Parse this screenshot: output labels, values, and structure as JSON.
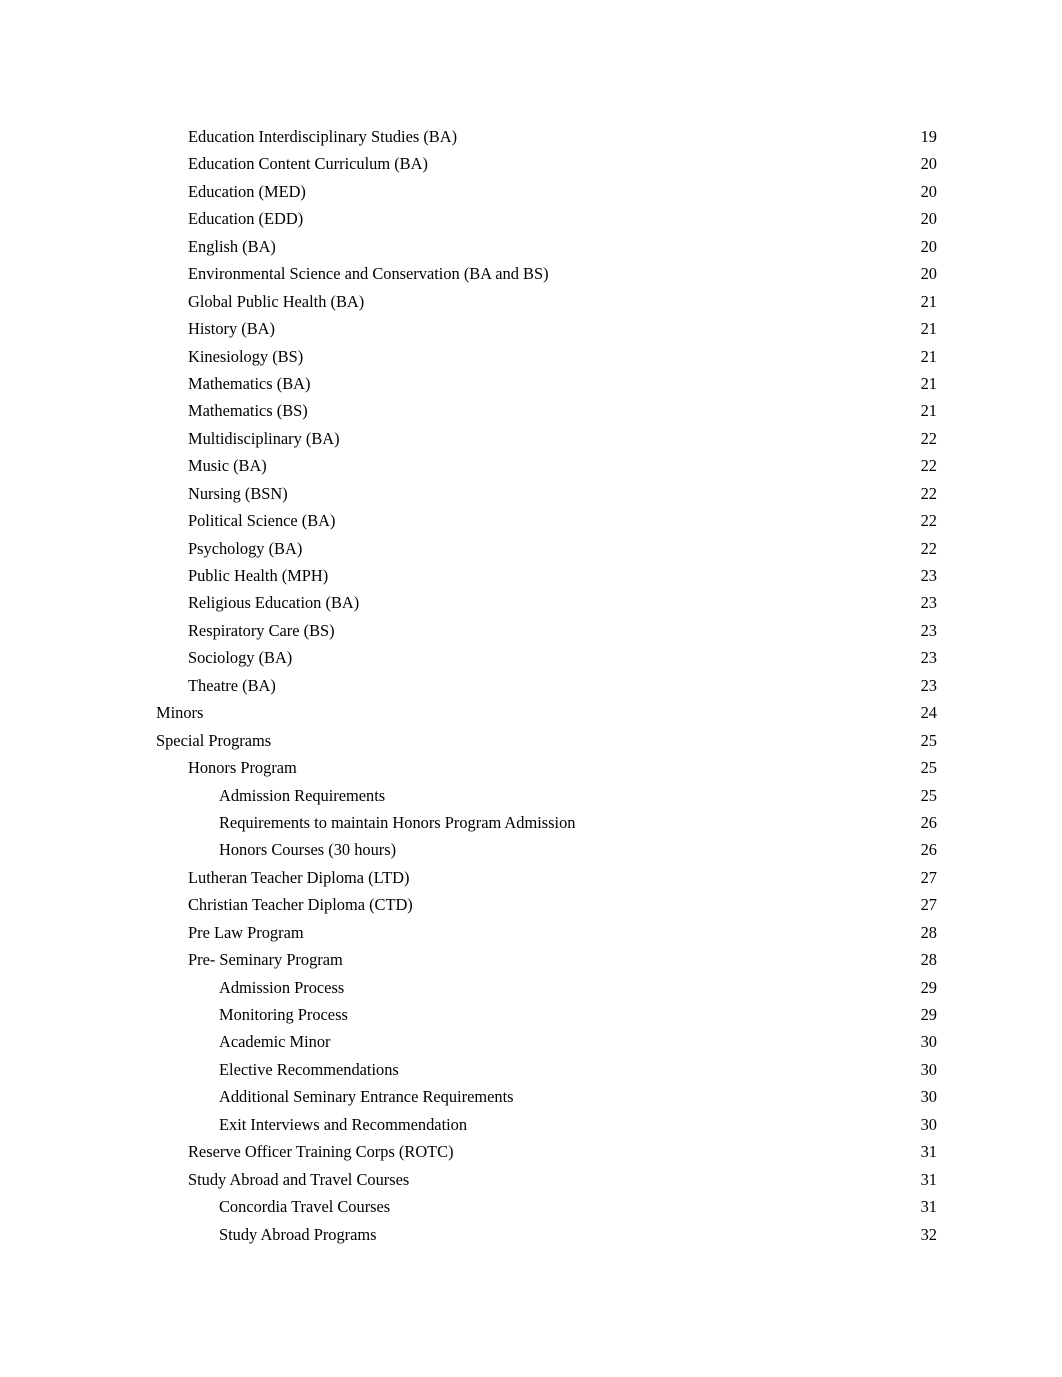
{
  "document": {
    "type": "table-of-contents",
    "page_background": "#ffffff",
    "text_color": "#000000"
  },
  "toc": {
    "entries": [
      {
        "title": "Education Interdisciplinary Studies (BA)",
        "page": "19",
        "level": 2
      },
      {
        "title": "Education Content Curriculum (BA)",
        "page": "20",
        "level": 2
      },
      {
        "title": "Education (MED)",
        "page": "20",
        "level": 2
      },
      {
        "title": "Education (EDD)",
        "page": "20",
        "level": 2
      },
      {
        "title": "English (BA)",
        "page": "20",
        "level": 2
      },
      {
        "title": "Environmental Science and Conservation (BA and BS)",
        "page": "20",
        "level": 2
      },
      {
        "title": "Global Public Health (BA)",
        "page": "21",
        "level": 2
      },
      {
        "title": "History (BA)",
        "page": "21",
        "level": 2
      },
      {
        "title": "Kinesiology (BS)",
        "page": "21",
        "level": 2
      },
      {
        "title": "Mathematics (BA)",
        "page": "21",
        "level": 2
      },
      {
        "title": "Mathematics (BS)",
        "page": "21",
        "level": 2
      },
      {
        "title": "Multidisciplinary (BA)",
        "page": "22",
        "level": 2
      },
      {
        "title": "Music (BA)",
        "page": "22",
        "level": 2
      },
      {
        "title": "Nursing (BSN)",
        "page": "22",
        "level": 2
      },
      {
        "title": "Political Science (BA)",
        "page": "22",
        "level": 2
      },
      {
        "title": "Psychology (BA)",
        "page": "22",
        "level": 2
      },
      {
        "title": "Public Health (MPH)",
        "page": "23",
        "level": 2
      },
      {
        "title": "Religious Education (BA)",
        "page": "23",
        "level": 2
      },
      {
        "title": "Respiratory Care (BS)",
        "page": "23",
        "level": 2
      },
      {
        "title": "Sociology (BA)",
        "page": "23",
        "level": 2
      },
      {
        "title": "Theatre (BA)",
        "page": "23",
        "level": 2
      },
      {
        "title": "Minors",
        "page": "24",
        "level": 1
      },
      {
        "title": "Special Programs",
        "page": "25",
        "level": 1
      },
      {
        "title": "Honors Program",
        "page": "25",
        "level": 2
      },
      {
        "title": "Admission Requirements",
        "page": "25",
        "level": 3
      },
      {
        "title": "Requirements to maintain Honors Program Admission",
        "page": "26",
        "level": 3
      },
      {
        "title": "Honors Courses (30 hours)",
        "page": "26",
        "level": 3
      },
      {
        "title": "Lutheran Teacher Diploma (LTD)",
        "page": "27",
        "level": 2
      },
      {
        "title": "Christian Teacher Diploma (CTD)",
        "page": "27",
        "level": 2
      },
      {
        "title": "Pre Law Program",
        "page": "28",
        "level": 2
      },
      {
        "title": "Pre- Seminary Program",
        "page": "28",
        "level": 2
      },
      {
        "title": "Admission Process",
        "page": "29",
        "level": 3
      },
      {
        "title": "Monitoring Process",
        "page": "29",
        "level": 3
      },
      {
        "title": "Academic Minor",
        "page": "30",
        "level": 3
      },
      {
        "title": "Elective Recommendations",
        "page": "30",
        "level": 3
      },
      {
        "title": "Additional Seminary Entrance Requirements",
        "page": "30",
        "level": 3
      },
      {
        "title": "Exit Interviews and Recommendation",
        "page": "30",
        "level": 3
      },
      {
        "title": "Reserve Officer Training Corps (ROTC)",
        "page": "31",
        "level": 2
      },
      {
        "title": "Study Abroad and Travel Courses",
        "page": "31",
        "level": 2
      },
      {
        "title": "Concordia Travel Courses",
        "page": "31",
        "level": 3
      },
      {
        "title": "Study Abroad Programs",
        "page": "32",
        "level": 3
      }
    ]
  }
}
